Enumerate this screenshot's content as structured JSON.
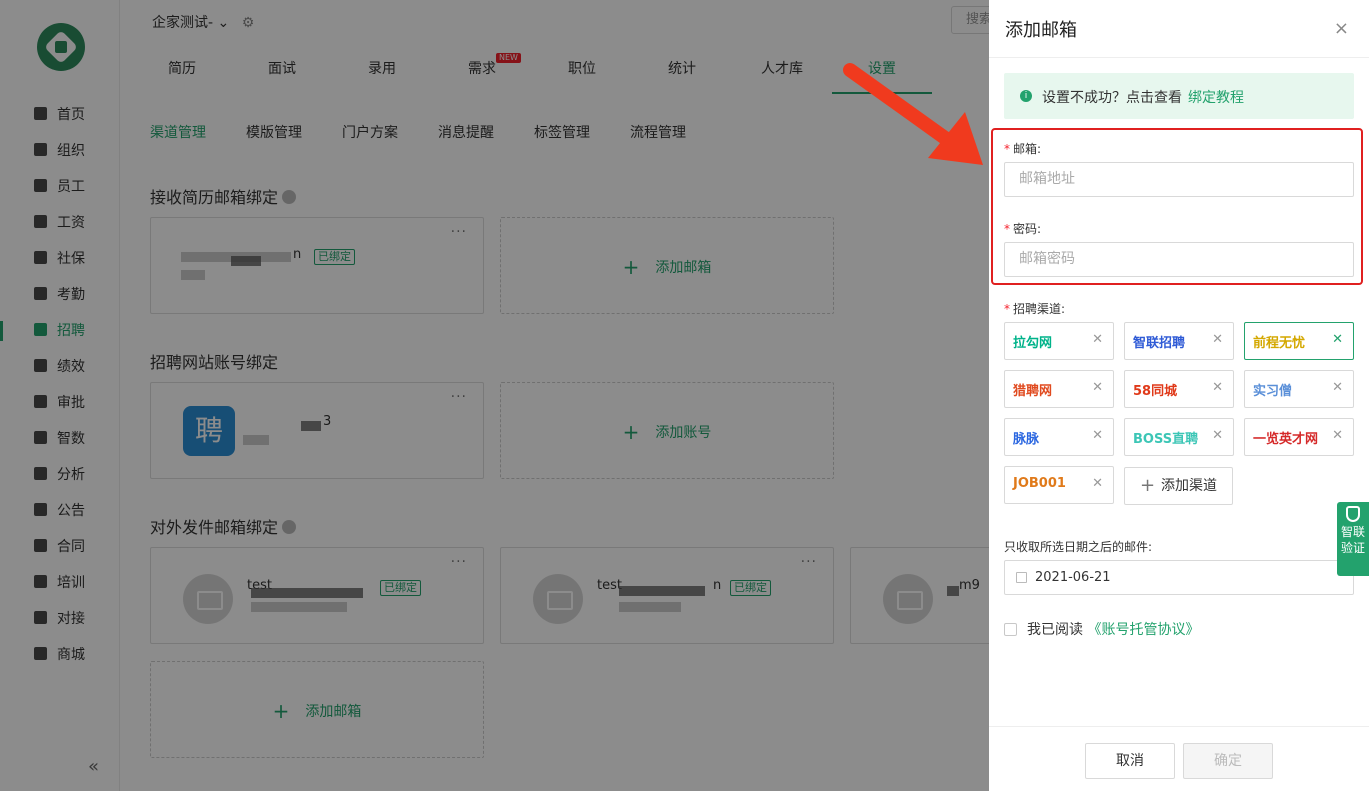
{
  "sidebar": {
    "items": [
      {
        "label": "首页"
      },
      {
        "label": "组织"
      },
      {
        "label": "员工"
      },
      {
        "label": "工资"
      },
      {
        "label": "社保"
      },
      {
        "label": "考勤"
      },
      {
        "label": "招聘"
      },
      {
        "label": "绩效"
      },
      {
        "label": "审批"
      },
      {
        "label": "智数"
      },
      {
        "label": "分析"
      },
      {
        "label": "公告"
      },
      {
        "label": "合同"
      },
      {
        "label": "培训"
      },
      {
        "label": "对接"
      },
      {
        "label": "商城"
      }
    ],
    "active_index": 6,
    "collapse_glyph": "«"
  },
  "header": {
    "company": "企家测试-",
    "search_placeholder": "搜索",
    "tabs": [
      {
        "label": "简历"
      },
      {
        "label": "面试"
      },
      {
        "label": "录用"
      },
      {
        "label": "需求"
      },
      {
        "label": "职位"
      },
      {
        "label": "统计"
      },
      {
        "label": "人才库"
      },
      {
        "label": "设置"
      }
    ],
    "new_badge": "NEW",
    "active_tab": "设置"
  },
  "main": {
    "subtabs": [
      {
        "label": "渠道管理"
      },
      {
        "label": "模版管理"
      },
      {
        "label": "门户方案"
      },
      {
        "label": "消息提醒"
      },
      {
        "label": "标签管理"
      },
      {
        "label": "流程管理"
      }
    ],
    "sections": {
      "resume_email": "接收简历邮箱绑定",
      "site_account": "招聘网站账号绑定",
      "outgoing_email": "对外发件邮箱绑定"
    },
    "bound_tag": "已绑定",
    "add_email": "添加邮箱",
    "add_account": "添加账号",
    "more": "···",
    "card_fragments": {
      "resume_suffix": "n",
      "account_suffix": "3",
      "out1_prefix": "test",
      "out2_prefix": "test",
      "out2_suffix": "n",
      "out3_prefix": "m9"
    },
    "account_logo_glyph": "聘"
  },
  "drawer": {
    "title": "添加邮箱",
    "close": "×",
    "alert_text": "设置不成功？点击查看",
    "alert_link": "绑定教程",
    "email_label": "邮箱:",
    "email_placeholder": "邮箱地址",
    "password_label": "密码:",
    "password_placeholder": "邮箱密码",
    "channel_label": "招聘渠道:",
    "channels": [
      {
        "name": "拉勾网",
        "color": "#00b38a"
      },
      {
        "name": "智联招聘",
        "color": "#2f5bd6"
      },
      {
        "name": "前程无忧",
        "color": "#d4a800"
      },
      {
        "name": "猎聘网",
        "color": "#e04a1f"
      },
      {
        "name": "58同城",
        "color": "#e03a1a"
      },
      {
        "name": "实习僧",
        "color": "#5a8fd8"
      },
      {
        "name": "脉脉",
        "color": "#2a66e0"
      },
      {
        "name": "BOSS直聘",
        "color": "#3cc6b6"
      },
      {
        "name": "一览英才网",
        "color": "#d52a2a"
      },
      {
        "name": "JOB001",
        "color": "#e07a1a"
      }
    ],
    "selected_channel": 2,
    "add_channel": "添加渠道",
    "date_label": "只收取所选日期之后的邮件:",
    "date_value": "2021-06-21",
    "agree_text": "我已阅读",
    "agree_link": "《账号托管协议》",
    "cancel": "取消",
    "confirm": "确定"
  },
  "verify": {
    "line1": "智联",
    "line2": "验证"
  },
  "colors": {
    "brand": "#23a26d",
    "alert_bg": "#e7f7ee",
    "highlight": "#e02020",
    "arrow": "#f03a1e"
  }
}
